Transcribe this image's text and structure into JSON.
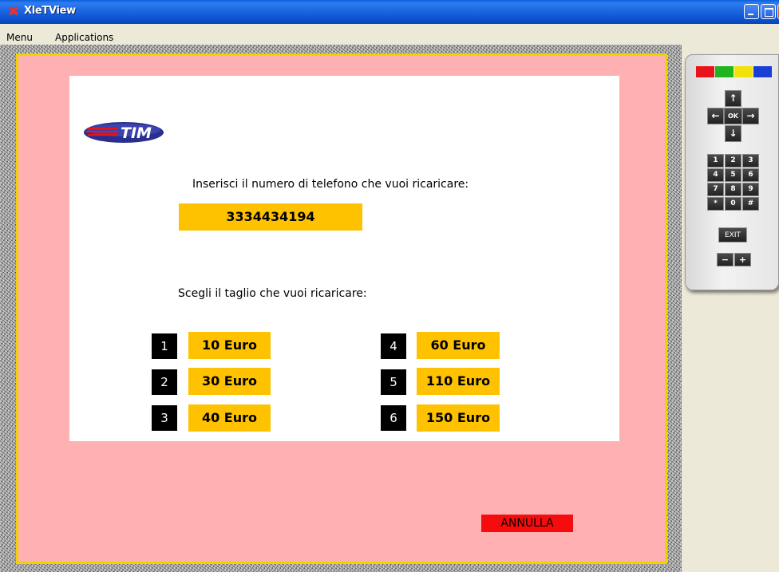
{
  "window": {
    "title": "XleTView"
  },
  "menu": {
    "items": [
      "Menu",
      "Applications"
    ]
  },
  "screen": {
    "logo_text": "TIM",
    "phone_prompt": "Inserisci il numero di telefono che vuoi ricaricare:",
    "phone_number": "3334434194",
    "amount_prompt": "Scegli il taglio che vuoi ricaricare:",
    "options": [
      {
        "num": "1",
        "label": "10 Euro"
      },
      {
        "num": "2",
        "label": "30 Euro"
      },
      {
        "num": "3",
        "label": "40 Euro"
      },
      {
        "num": "4",
        "label": "60 Euro"
      },
      {
        "num": "5",
        "label": "110 Euro"
      },
      {
        "num": "6",
        "label": "150 Euro"
      }
    ],
    "cancel_label": "ANNULLA"
  },
  "remote": {
    "color_buttons": [
      "#e8141a",
      "#1fb51f",
      "#f2e20a",
      "#1a3fd6"
    ],
    "nav": {
      "up": "↑",
      "down": "↓",
      "left": "←",
      "right": "→",
      "ok": "OK"
    },
    "keys": [
      "1",
      "2",
      "3",
      "4",
      "5",
      "6",
      "7",
      "8",
      "9",
      "*",
      "0",
      "#"
    ],
    "exit_label": "EXIT",
    "minus_label": "−",
    "plus_label": "+"
  },
  "colors": {
    "screen_bg": "#ffb0b3",
    "accent": "#ffc200",
    "cancel": "#f50c0c"
  }
}
